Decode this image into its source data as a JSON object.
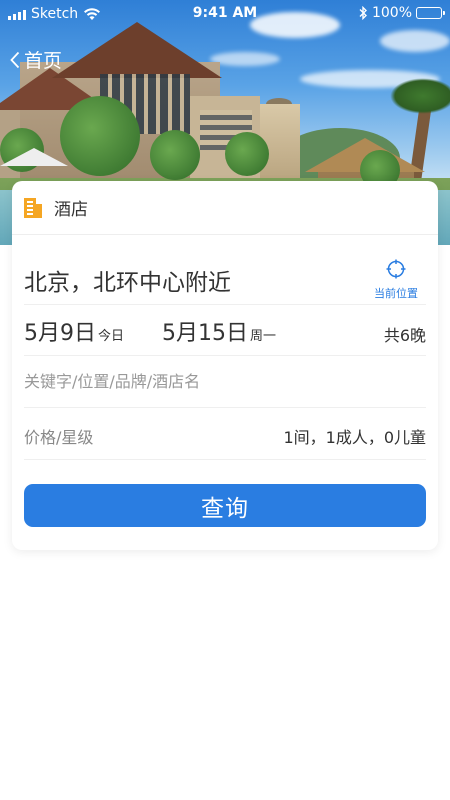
{
  "status_bar": {
    "carrier": "Sketch",
    "time": "9:41 AM",
    "battery": "100%"
  },
  "nav": {
    "back_label": "首页"
  },
  "card": {
    "title": "酒店",
    "destination": "北京，北环中心附近",
    "location_button_label": "当前位置",
    "checkin_date": "5月9日",
    "checkin_day": "今日",
    "checkout_date": "5月15日",
    "checkout_day": "周一",
    "nights": "共6晚",
    "keyword_placeholder": "关键字/位置/品牌/酒店名",
    "price_star_label": "价格/星级",
    "guests_summary": "1间，1成人，0儿童",
    "search_button_label": "查询"
  },
  "colors": {
    "accent": "#2a7de1",
    "hotel_icon": "#f5a623"
  }
}
